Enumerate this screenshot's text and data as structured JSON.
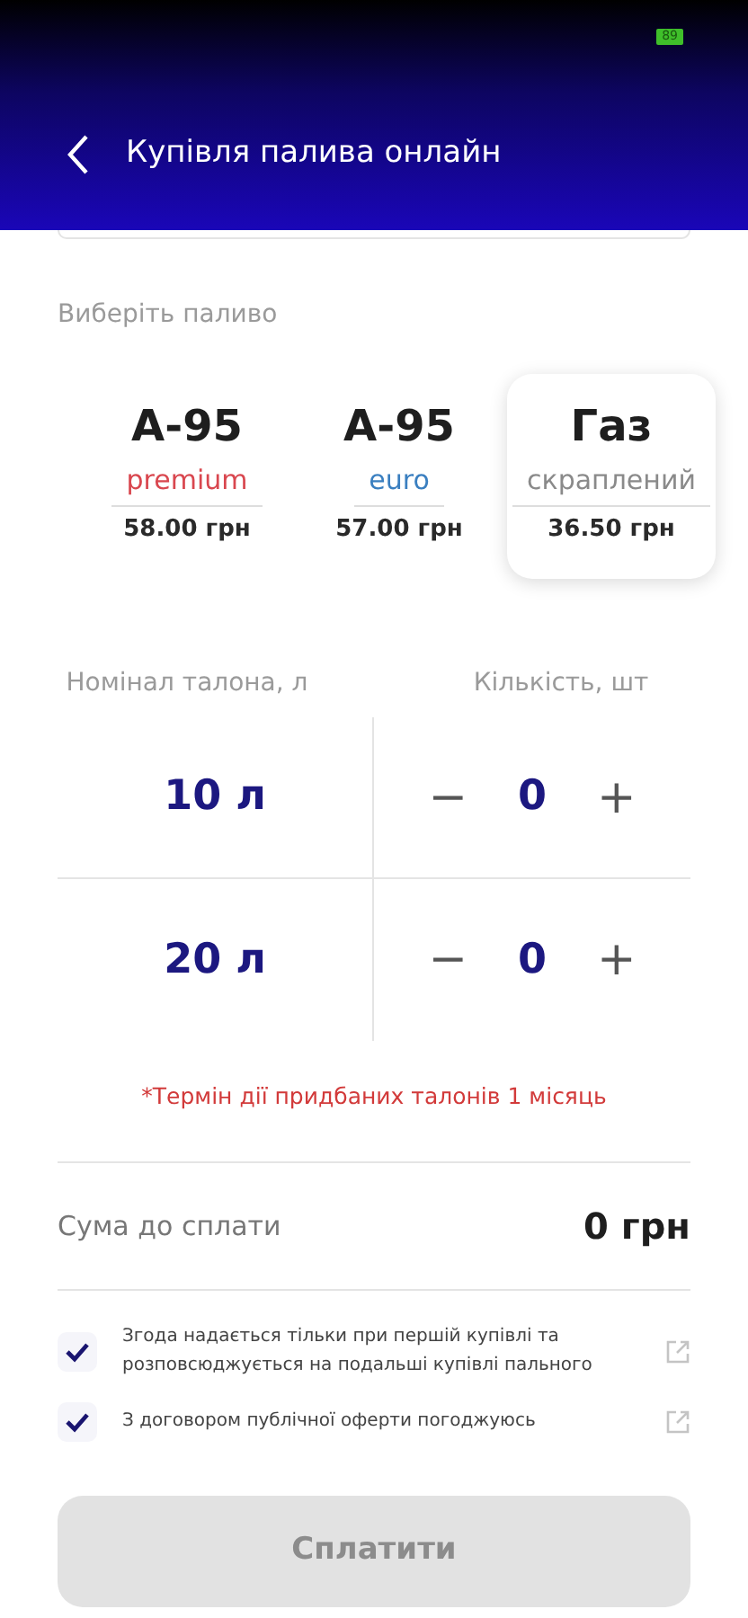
{
  "status_bar": {
    "battery": "89"
  },
  "header": {
    "title": "Купівля палива онлайн"
  },
  "fuel_section": {
    "label": "Виберіть паливо"
  },
  "fuels": [
    {
      "name": "А-95",
      "grade": "premium",
      "color": "#d9474f",
      "price": "58.00 грн",
      "selected": false
    },
    {
      "name": "А-95",
      "grade": "euro",
      "color": "#3a7fc0",
      "price": "57.00 грн",
      "selected": false
    },
    {
      "name": "Газ",
      "grade": "скраплений",
      "color": "#8a8a8a",
      "price": "36.50 грн",
      "selected": true
    }
  ],
  "coupons": {
    "columns": [
      "Номінал талона, л",
      "Кількість, шт"
    ],
    "rows": [
      {
        "nominal": "10 л",
        "minus": "−",
        "count": "0",
        "plus": "+"
      },
      {
        "nominal": "20 л",
        "minus": "−",
        "count": "0",
        "plus": "+"
      }
    ],
    "note": "*Термін дії придбаних талонів 1 місяць"
  },
  "total": {
    "label": "Сума до сплати",
    "value": "0 грн"
  },
  "agreements": [
    {
      "text": "Згода надається тільки при першій купівлі та розповсюджується на подальші купівлі пального",
      "checked": true
    },
    {
      "text": "З договором публічної оферти погоджуюсь",
      "checked": true
    }
  ],
  "pay_button": {
    "label": "Сплатити",
    "disabled": true
  }
}
